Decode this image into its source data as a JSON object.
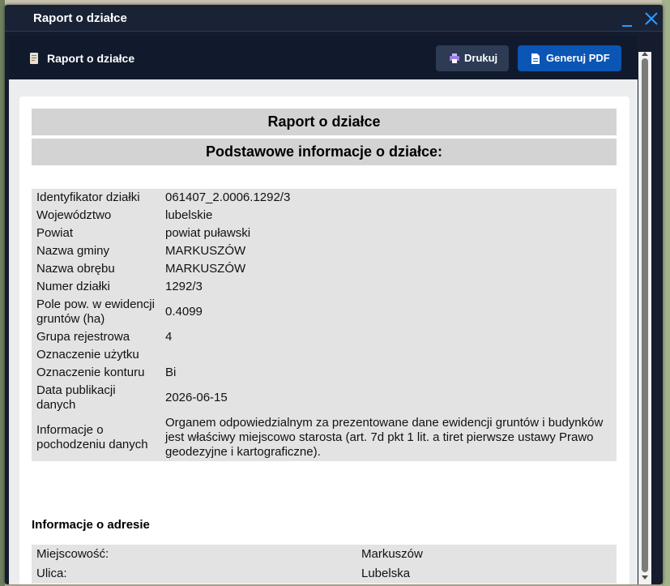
{
  "window": {
    "title": "Raport o działce"
  },
  "toolbar": {
    "title": "Raport o działce",
    "print_label": "Drukuj",
    "pdf_label": "Generuj PDF"
  },
  "report": {
    "title": "Raport o działce",
    "section_basic": "Podstawowe informacje o działce:",
    "rows": [
      {
        "label": "Identyfikator działki",
        "value": "061407_2.0006.1292/3"
      },
      {
        "label": "Województwo",
        "value": "lubelskie"
      },
      {
        "label": "Powiat",
        "value": "powiat puławski"
      },
      {
        "label": "Nazwa gminy",
        "value": "MARKUSZÓW"
      },
      {
        "label": "Nazwa obrębu",
        "value": "MARKUSZÓW"
      },
      {
        "label": "Numer działki",
        "value": "1292/3"
      },
      {
        "label": "Pole pow. w ewidencji gruntów (ha)",
        "value": "0.4099"
      },
      {
        "label": "Grupa rejestrowa",
        "value": "4"
      },
      {
        "label": "Oznaczenie użytku",
        "value": ""
      },
      {
        "label": "Oznaczenie konturu",
        "value": "Bi"
      },
      {
        "label": "Data publikacji danych",
        "value": "2026-06-15"
      },
      {
        "label": "Informacje o pochodzeniu danych",
        "value": "Organem odpowiedzialnym za prezentowane dane ewidencji gruntów i budynków jest właściwy miejscowo starosta (art. 7d pkt 1 lit. a tiret pierwsze ustawy Prawo geodezyjne i kartograficzne)."
      }
    ],
    "section_address": "Informacje o adresie",
    "address_rows": [
      {
        "label": "Miejscowość:",
        "value": "Markuszów"
      },
      {
        "label": "Ulica:",
        "value": "Lubelska"
      }
    ]
  },
  "colors": {
    "window_bg": "#151c2e",
    "pdf_button": "#0b55b5",
    "print_button": "#2d3b54",
    "accent_icon": "#2b9bff"
  },
  "icons": {
    "close": "close-icon",
    "minimize": "minimize-icon",
    "document": "document-icon",
    "printer": "printer-icon",
    "pdf": "file-icon"
  }
}
